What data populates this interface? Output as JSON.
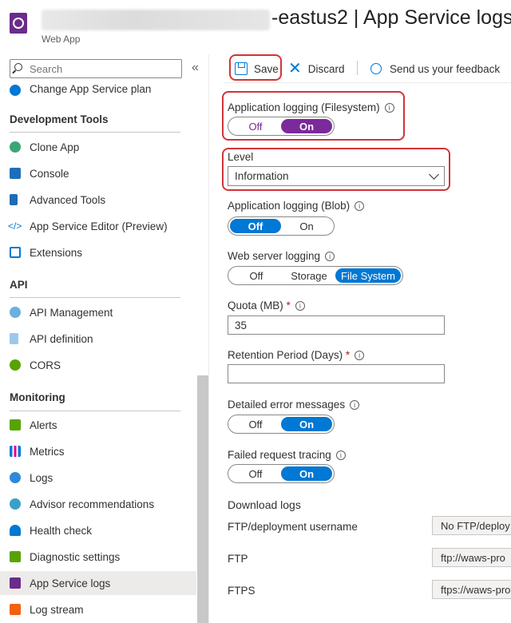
{
  "header": {
    "title": "-eastus2 | App Service logs",
    "subtitle": "Web App"
  },
  "sidebar": {
    "search_placeholder": "Search",
    "collapse_glyph": "«",
    "top_item": "Change App Service plan",
    "sections": [
      {
        "title": "Development Tools",
        "items": [
          "Clone App",
          "Console",
          "Advanced Tools",
          "App Service Editor (Preview)",
          "Extensions"
        ]
      },
      {
        "title": "API",
        "items": [
          "API Management",
          "API definition",
          "CORS"
        ]
      },
      {
        "title": "Monitoring",
        "items": [
          "Alerts",
          "Metrics",
          "Logs",
          "Advisor recommendations",
          "Health check",
          "Diagnostic settings",
          "App Service logs",
          "Log stream"
        ]
      }
    ],
    "active_item": "App Service logs"
  },
  "toolbar": {
    "save": "Save",
    "discard": "Discard",
    "feedback": "Send us your feedback"
  },
  "form": {
    "app_logging_fs": {
      "label": "Application logging (Filesystem)",
      "off": "Off",
      "on": "On",
      "selected": "On"
    },
    "level": {
      "label": "Level",
      "value": "Information"
    },
    "app_logging_blob": {
      "label": "Application logging (Blob)",
      "off": "Off",
      "on": "On",
      "selected": "Off"
    },
    "web_server_logging": {
      "label": "Web server logging",
      "off": "Off",
      "storage": "Storage",
      "fs": "File System",
      "selected": "File System"
    },
    "quota": {
      "label": "Quota (MB)",
      "required": "*",
      "value": "35"
    },
    "retention": {
      "label": "Retention Period (Days)",
      "required": "*",
      "value": ""
    },
    "detailed_errors": {
      "label": "Detailed error messages",
      "off": "Off",
      "on": "On",
      "selected": "On"
    },
    "failed_request": {
      "label": "Failed request tracing",
      "off": "Off",
      "on": "On",
      "selected": "On"
    },
    "download_logs": {
      "label": "Download logs"
    },
    "ftp_user": {
      "label": "FTP/deployment username",
      "value": "No FTP/deploy"
    },
    "ftp": {
      "label": "FTP",
      "value": "ftp://waws-pro"
    },
    "ftps": {
      "label": "FTPS",
      "value": "ftps://waws-pro"
    }
  },
  "colors": {
    "accent": "#0078d4",
    "toggle_purple": "#7b2a9b",
    "highlight_red": "#d13438"
  }
}
